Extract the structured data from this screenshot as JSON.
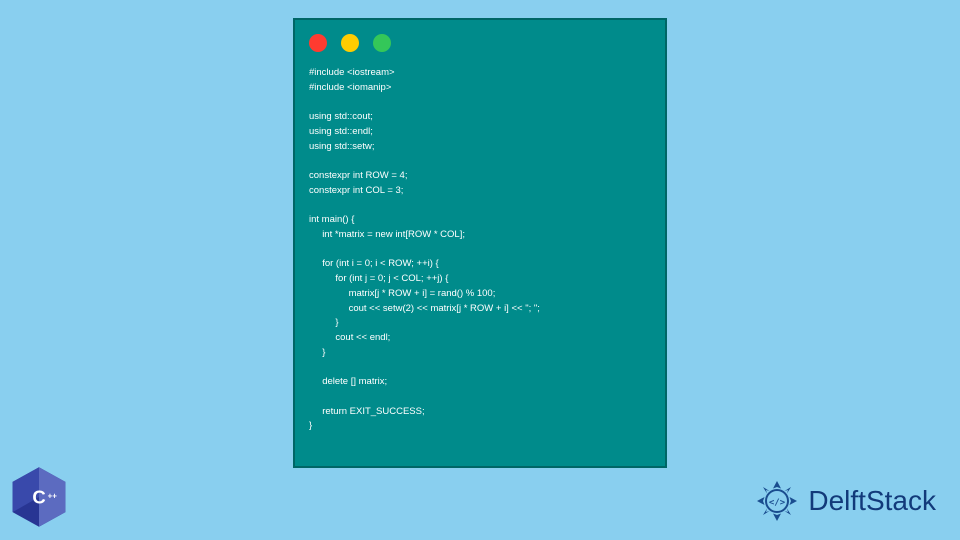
{
  "window": {
    "controls": {
      "close": "close",
      "minimize": "minimize",
      "maximize": "maximize"
    }
  },
  "code": {
    "content": "#include <iostream>\n#include <iomanip>\n\nusing std::cout;\nusing std::endl;\nusing std::setw;\n\nconstexpr int ROW = 4;\nconstexpr int COL = 3;\n\nint main() {\n     int *matrix = new int[ROW * COL];\n\n     for (int i = 0; i < ROW; ++i) {\n          for (int j = 0; j < COL; ++j) {\n               matrix[j * ROW + i] = rand() % 100;\n               cout << setw(2) << matrix[j * ROW + i] << \"; \";\n          }\n          cout << endl;\n     }\n\n     delete [] matrix;\n\n     return EXIT_SUCCESS;\n}"
  },
  "badges": {
    "cpp": "C++",
    "delftstack": "DelftStack"
  }
}
